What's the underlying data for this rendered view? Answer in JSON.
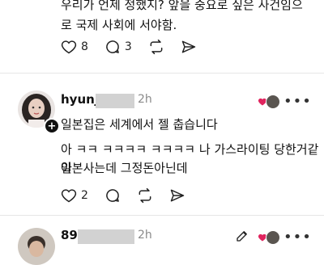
{
  "post_top": {
    "text_line1": "우리가 언제 정했지? 앞을 중요로 싶은 사건임으",
    "text_line2": "로 국제 사회에 서야함.",
    "likes": "8",
    "comments": "3"
  },
  "comment1": {
    "username": "hyunj",
    "time": "2h",
    "more": "•••",
    "line1": "일본집은 세계에서 젤 춥습니다",
    "line2": "아 ㅋㅋ ㅋㅋㅋㅋ ㅋㅋㅋㅋ 나 가스라이팅 당한거같아",
    "line3": "일본사는데  그정돈아닌데",
    "likes": "2"
  },
  "comment2": {
    "username": "89",
    "time": "2h",
    "more": "•••"
  },
  "colors": {
    "heart_red": "#e0245e",
    "muted": "#8a8a8a",
    "redaction": "#d2d2d2"
  }
}
